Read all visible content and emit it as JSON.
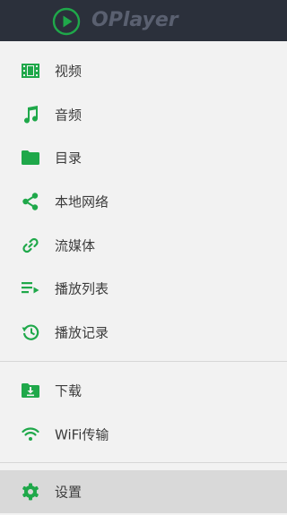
{
  "app": {
    "name": "OPlayer",
    "accent_color": "#1fa84a",
    "header_bg": "#2b303b"
  },
  "menu": {
    "items": [
      {
        "label": "视频",
        "icon": "video-icon"
      },
      {
        "label": "音频",
        "icon": "music-note-icon"
      },
      {
        "label": "目录",
        "icon": "folder-icon"
      },
      {
        "label": "本地网络",
        "icon": "share-icon"
      },
      {
        "label": "流媒体",
        "icon": "link-icon"
      },
      {
        "label": "播放列表",
        "icon": "playlist-icon"
      },
      {
        "label": "播放记录",
        "icon": "history-icon"
      }
    ],
    "secondary": [
      {
        "label": "下载",
        "icon": "download-icon"
      },
      {
        "label": "WiFi传输",
        "icon": "wifi-icon"
      }
    ],
    "settings": {
      "label": "设置",
      "icon": "gear-icon",
      "selected": true
    }
  }
}
